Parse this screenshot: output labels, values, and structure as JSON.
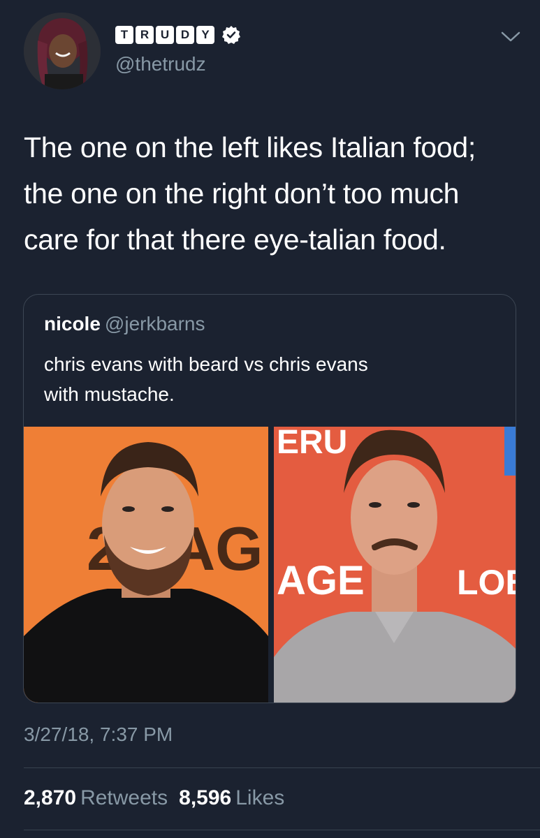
{
  "author": {
    "name_letters": [
      "T",
      "R",
      "U",
      "D",
      "Y"
    ],
    "handle": "@thetrudz",
    "verified_icon": "verified-badge-icon"
  },
  "tweet": {
    "lines": [
      "The one on the left likes Italian food;",
      "the one on the right don’t too much",
      "care for that there eye-talian food."
    ]
  },
  "quoted_tweet": {
    "name": "nicole",
    "handle": "@jerkbarns",
    "lines": [
      "chris evans with beard vs chris evans",
      "with mustache."
    ],
    "left_photo_text": "2 TAG",
    "right_photo_text_top": "ERU",
    "right_photo_text_mid": "AGE",
    "right_photo_text_right": "LOBE"
  },
  "timestamp": "3/27/18, 7:37 PM",
  "stats": {
    "retweets_count": "2,870",
    "retweets_label": "Retweets",
    "likes_count": "8,596",
    "likes_label": "Likes"
  },
  "colors": {
    "background": "#1b2230",
    "muted_text": "#8899a6",
    "border": "#3d4754"
  }
}
